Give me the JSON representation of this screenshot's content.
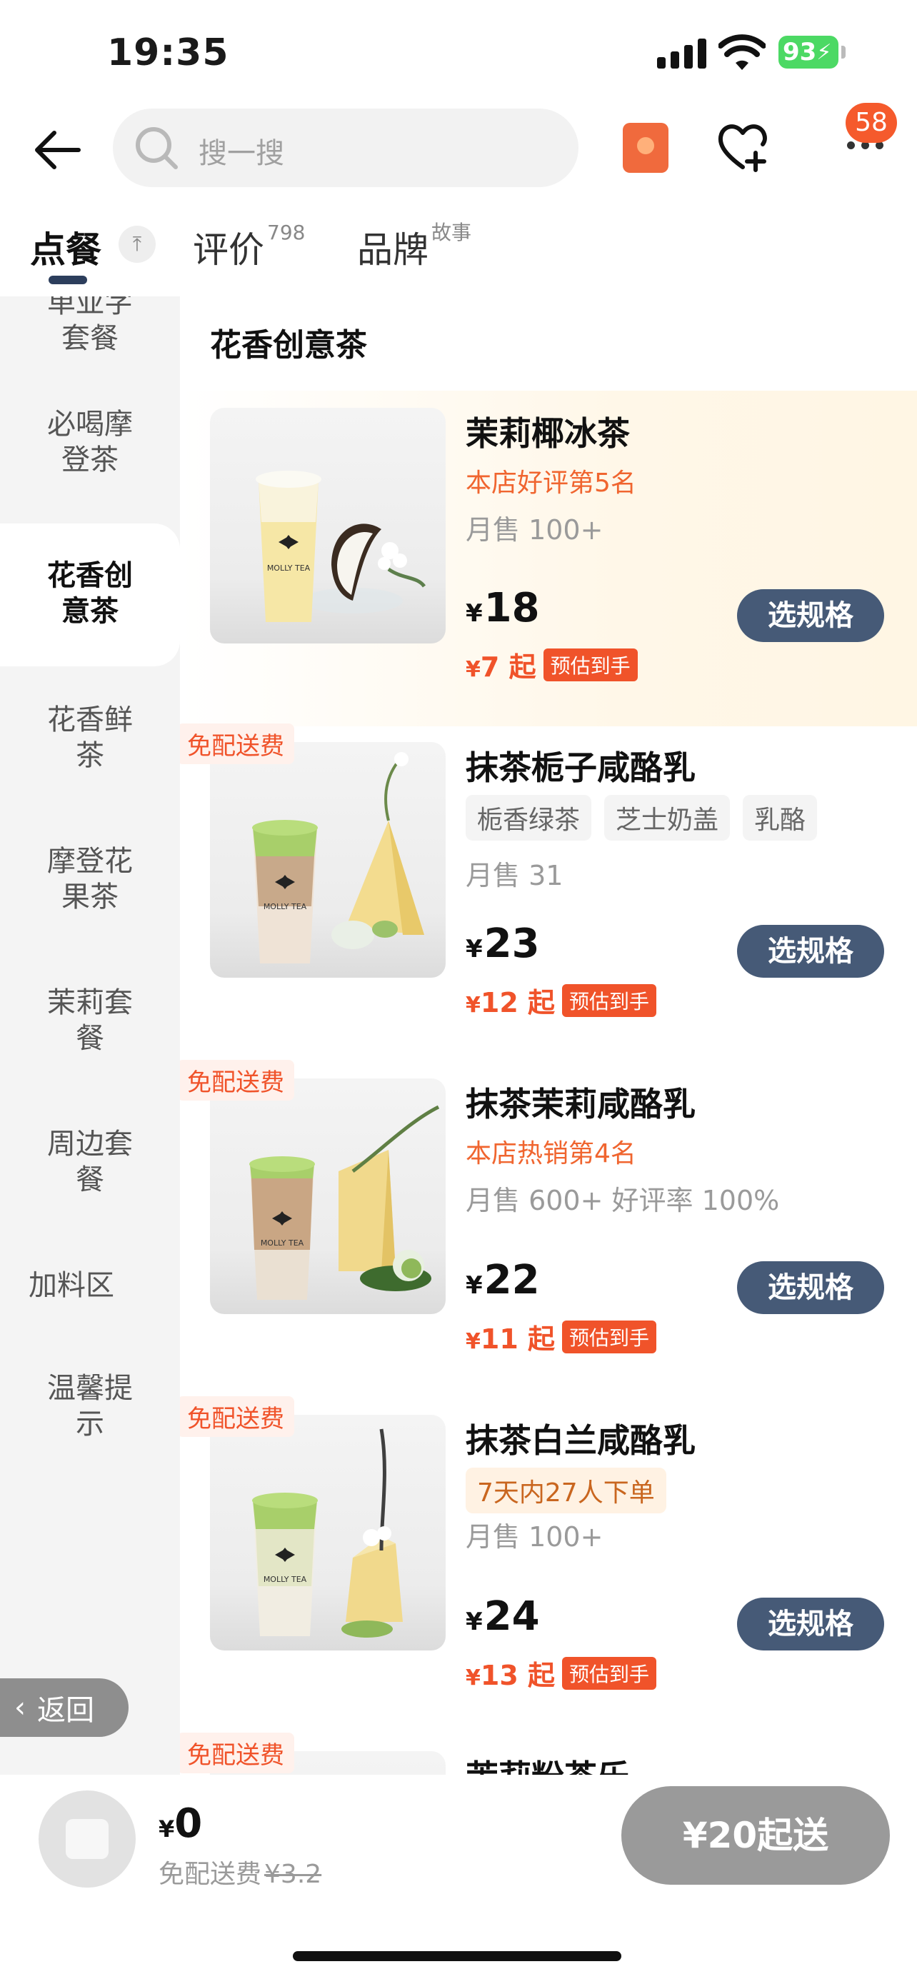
{
  "status_bar": {
    "time": "19:35",
    "battery": "93"
  },
  "header": {
    "search_placeholder": "搜一搜",
    "cart_badge": "58"
  },
  "tabs": [
    {
      "label": "点餐",
      "sup": ""
    },
    {
      "label": "评价",
      "sup": "798"
    },
    {
      "label": "品牌",
      "sup": "故事"
    }
  ],
  "sidebar": {
    "items": [
      {
        "label": "单亚字\n套餐"
      },
      {
        "label": "必喝摩\n登茶"
      },
      {
        "label": "花香创\n意茶"
      },
      {
        "label": "花香鲜\n茶"
      },
      {
        "label": "摩登花\n果茶"
      },
      {
        "label": "茉莉套\n餐"
      },
      {
        "label": "周边套\n餐"
      },
      {
        "label": "加料区"
      },
      {
        "label": "温馨提\n示"
      }
    ],
    "back_label": "返回"
  },
  "section_title": "花香创意茶",
  "products": [
    {
      "name": "茉莉椰冰茶",
      "highlight": "本店好评第5名",
      "chips": [],
      "sales": "月售 100+",
      "currency": "¥",
      "price": "18",
      "estimate": "7",
      "estimate_suffix": "起",
      "estimate_label": "预估到手",
      "button": "选规格",
      "free_delivery": ""
    },
    {
      "name": "抹茶栀子咸酪乳",
      "highlight": "",
      "chips": [
        "栀香绿茶",
        "芝士奶盖",
        "乳酪"
      ],
      "sales": "月售 31",
      "currency": "¥",
      "price": "23",
      "estimate": "12",
      "estimate_suffix": "起",
      "estimate_label": "预估到手",
      "button": "选规格",
      "free_delivery": "免配送费"
    },
    {
      "name": "抹茶茉莉咸酪乳",
      "highlight": "本店热销第4名",
      "chips": [],
      "sales": "月售 600+ 好评率 100%",
      "currency": "¥",
      "price": "22",
      "estimate": "11",
      "estimate_suffix": "起",
      "estimate_label": "预估到手",
      "button": "选规格",
      "free_delivery": "免配送费"
    },
    {
      "name": "抹茶白兰咸酪乳",
      "highlight": "",
      "chips": [
        "7天内27人下单"
      ],
      "sales": "月售 100+",
      "currency": "¥",
      "price": "24",
      "estimate": "13",
      "estimate_suffix": "起",
      "estimate_label": "预估到手",
      "button": "选规格",
      "free_delivery": "免配送费"
    },
    {
      "name": "茉莉粉茶乐",
      "free_delivery": "免配送费"
    }
  ],
  "cart": {
    "currency": "¥",
    "total": "0",
    "fee_label": "免配送费",
    "fee_original": "¥3.2",
    "checkout": "¥20起送"
  }
}
